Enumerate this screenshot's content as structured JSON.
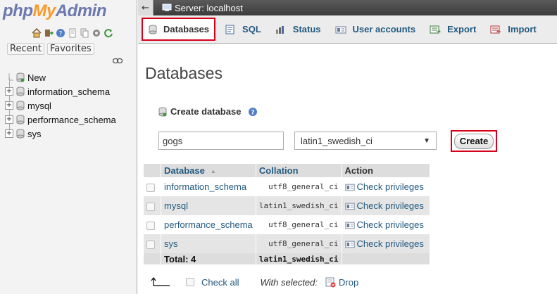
{
  "sidebar": {
    "logo": {
      "php": "php",
      "my": "My",
      "admin": "Admin"
    },
    "recent_label": "Recent",
    "favorites_label": "Favorites",
    "tree": [
      {
        "label": "New",
        "expandable": false
      },
      {
        "label": "information_schema",
        "expandable": true
      },
      {
        "label": "mysql",
        "expandable": true
      },
      {
        "label": "performance_schema",
        "expandable": true
      },
      {
        "label": "sys",
        "expandable": true
      }
    ]
  },
  "topbar": {
    "back": "←",
    "server": "Server: localhost"
  },
  "tabs": [
    {
      "label": "Databases",
      "icon": "database-icon",
      "active": true
    },
    {
      "label": "SQL",
      "icon": "sql-icon",
      "active": false
    },
    {
      "label": "Status",
      "icon": "status-icon",
      "active": false
    },
    {
      "label": "User accounts",
      "icon": "users-icon",
      "active": false
    },
    {
      "label": "Export",
      "icon": "export-icon",
      "active": false
    },
    {
      "label": "Import",
      "icon": "import-icon",
      "active": false
    }
  ],
  "main": {
    "title": "Databases",
    "create_label": "Create database",
    "dbname_value": "gogs",
    "collation_value": "latin1_swedish_ci",
    "create_button": "Create"
  },
  "table": {
    "headers": {
      "database": "Database",
      "collation": "Collation",
      "action": "Action"
    },
    "rows": [
      {
        "name": "information_schema",
        "collation": "utf8_general_ci",
        "action": "Check privileges"
      },
      {
        "name": "mysql",
        "collation": "latin1_swedish_ci",
        "action": "Check privileges"
      },
      {
        "name": "performance_schema",
        "collation": "utf8_general_ci",
        "action": "Check privileges"
      },
      {
        "name": "sys",
        "collation": "utf8_general_ci",
        "action": "Check privileges"
      }
    ],
    "total_label": "Total: 4",
    "total_collation": "latin1_swedish_ci"
  },
  "footer": {
    "check_all": "Check all",
    "with_selected": "With selected:",
    "drop": "Drop"
  },
  "colors": {
    "accent_red": "#d7001b",
    "link_blue": "#235a81",
    "logo_blue": "#6c78af",
    "logo_orange": "#f89b2b"
  }
}
